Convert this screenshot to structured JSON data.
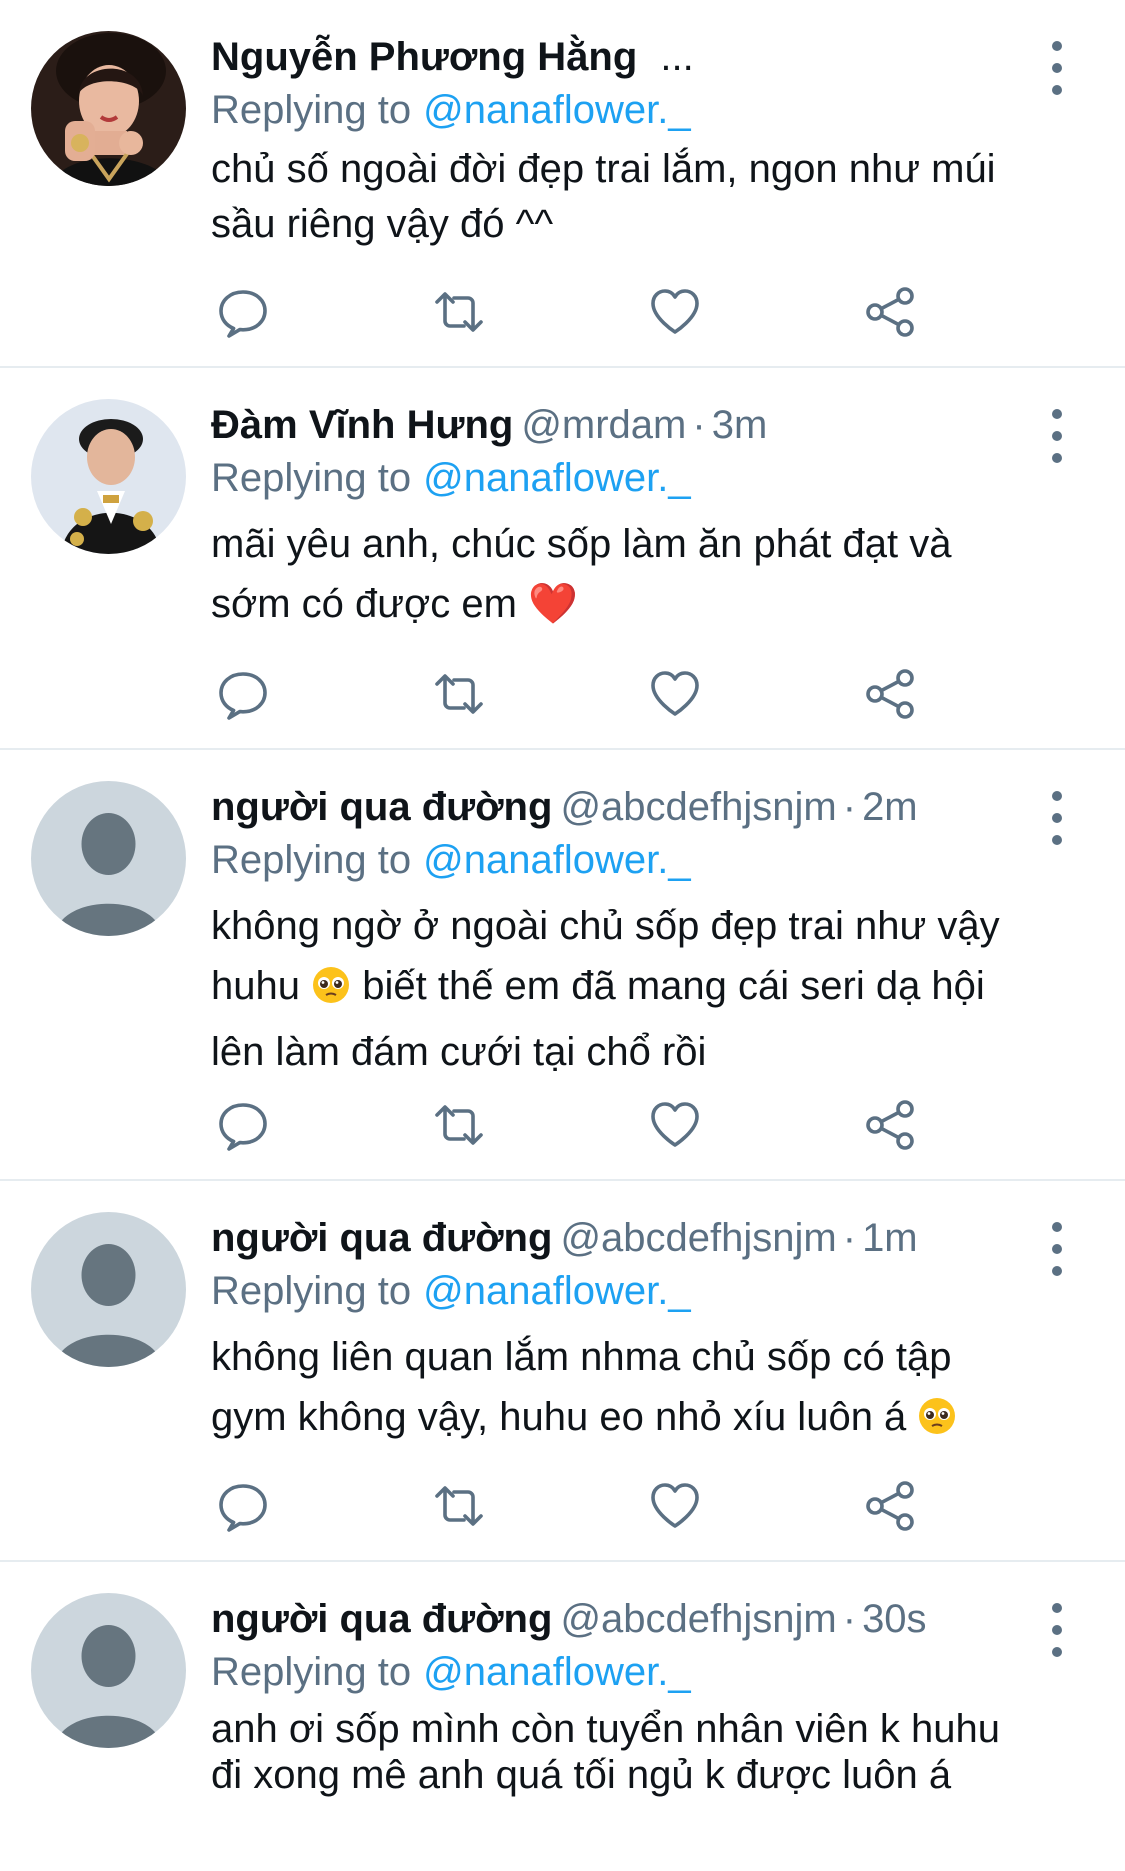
{
  "colors": {
    "accent": "#1da1f2",
    "secondary_text": "#5b7083",
    "primary_text": "#0f1419",
    "divider": "#e6ecf0",
    "default_avatar_bg": "#ccd6dd",
    "default_avatar_fg": "#66757f"
  },
  "icons": {
    "reply": "reply-icon",
    "retweet": "retweet-icon",
    "like": "heart-icon",
    "share": "share-icon",
    "more": "more-vertical-icon"
  },
  "tweets": [
    {
      "name": "Nguyễn Phương Hằng",
      "handle": "",
      "time": "",
      "truncated": "...",
      "replying_label": "Replying to",
      "mention": "@nanaflower._",
      "body": "chủ số ngoài đời đẹp trai lắm, ngon như múi sầu riêng vậy đó ^^"
    },
    {
      "name": "Đàm Vĩnh Hưng",
      "handle": "@mrdam",
      "sep": "·",
      "time": "3m",
      "replying_label": "Replying to",
      "mention": "@nanaflower._",
      "body_text": "mãi yêu anh, chúc sốp làm ăn phát đạt và sớm có được em",
      "body_emoji": "❤️"
    },
    {
      "name": "người qua đường",
      "handle": "@abcdefhjsnjm",
      "sep": "·",
      "time": "2m",
      "replying_label": "Replying to",
      "mention": "@nanaflower._",
      "body_part1": "không ngờ ở ngoài chủ sốp đẹp trai như vậy huhu",
      "body_part2": "biết thế em đã mang cái seri dạ hội lên làm đám cưới tại chổ rồi"
    },
    {
      "name": "người qua đường",
      "handle": "@abcdefhjsnjm",
      "sep": "·",
      "time": "1m",
      "replying_label": "Replying to",
      "mention": "@nanaflower._",
      "body_text": "không liên quan lắm nhma chủ sốp có tập gym không vậy, huhu eo nhỏ xíu luôn á"
    },
    {
      "name": "người qua đường",
      "handle": "@abcdefhjsnjm",
      "sep": "·",
      "time": "30s",
      "replying_label": "Replying to",
      "mention": "@nanaflower._",
      "body": "anh ơi sốp mình còn tuyển nhân viên k huhu đi xong mê anh quá tối ngủ k được luôn á"
    }
  ]
}
